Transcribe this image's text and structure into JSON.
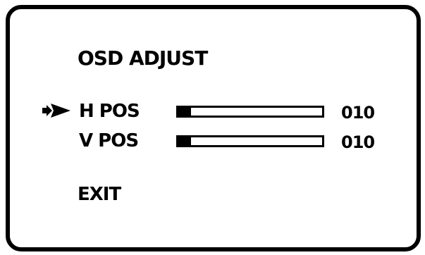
{
  "osd": {
    "title": "OSD ADJUST",
    "selected_item": "h-pos",
    "items": [
      {
        "id": "h-pos",
        "label": "H POS",
        "value": "010",
        "level_fraction": 0.09
      },
      {
        "id": "v-pos",
        "label": "V POS",
        "value": "010",
        "level_fraction": 0.09
      }
    ],
    "exit_label": "EXIT",
    "selector_icon": "right-arrow-pointer-icon",
    "colors": {
      "foreground": "#000000",
      "background": "#ffffff"
    }
  }
}
